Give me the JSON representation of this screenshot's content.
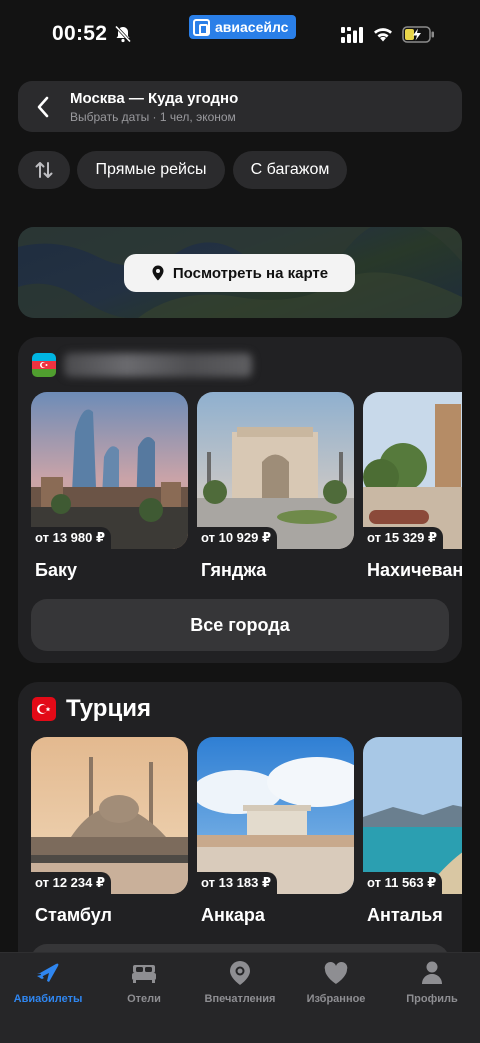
{
  "status_bar": {
    "time": "00:52",
    "brand": "авиасейлс",
    "icons": [
      "bell-off-icon",
      "signal-icon",
      "wifi-icon",
      "battery-charging-icon"
    ]
  },
  "search": {
    "route": "Москва — Куда угодно",
    "details": "Выбрать даты · 1 чел, эконом"
  },
  "filters": {
    "sort_icon": "sort-arrows-icon",
    "direct": "Прямые рейсы",
    "baggage": "С багажом"
  },
  "map": {
    "button_label": "Посмотреть на карте",
    "icon": "location-pin-icon"
  },
  "countries": [
    {
      "name": "",
      "flag": "azerbaijan-flag",
      "cities": [
        {
          "name": "Баку",
          "price": "от 13 980 ₽"
        },
        {
          "name": "Гянджа",
          "price": "от 10 929 ₽"
        },
        {
          "name": "Нахичевань",
          "price": "от 15 329 ₽"
        }
      ],
      "all_cities_label": "Все города"
    },
    {
      "name": "Турция",
      "flag": "turkey-flag",
      "cities": [
        {
          "name": "Стамбул",
          "price": "от 12 234 ₽"
        },
        {
          "name": "Анкара",
          "price": "от 13 183 ₽"
        },
        {
          "name": "Анталья",
          "price": "от 11 563 ₽"
        }
      ]
    }
  ],
  "tabbar": {
    "items": [
      {
        "label": "Авиабилеты",
        "icon": "airplane-icon",
        "active": true
      },
      {
        "label": "Отели",
        "icon": "bed-icon",
        "active": false
      },
      {
        "label": "Впечатления",
        "icon": "camera-icon",
        "active": false
      },
      {
        "label": "Избранное",
        "icon": "heart-icon",
        "active": false
      },
      {
        "label": "Профиль",
        "icon": "person-icon",
        "active": false
      }
    ]
  },
  "colors": {
    "background": "#131313",
    "card": "#212123",
    "chip": "#2b2b2d",
    "accent": "#2f86f0",
    "brand": "#2a7fe8"
  }
}
